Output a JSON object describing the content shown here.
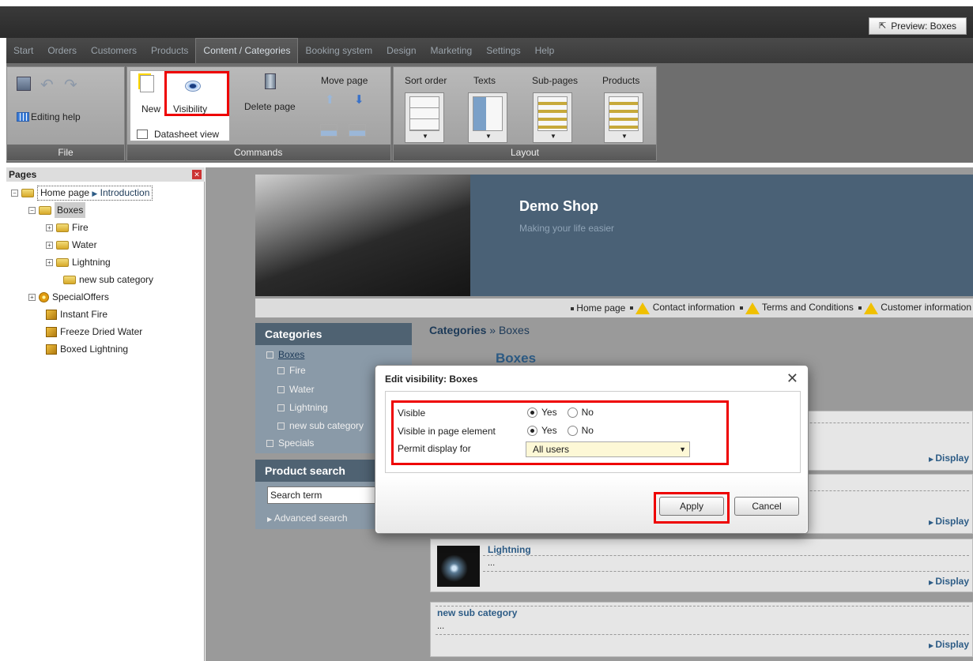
{
  "topbar": {
    "preview_label": "Preview: Boxes"
  },
  "menu": [
    "Start",
    "Orders",
    "Customers",
    "Products",
    "Content / Categories",
    "Booking system",
    "Design",
    "Marketing",
    "Settings",
    "Help"
  ],
  "ribbon": {
    "file": {
      "editing_help": "Editing help",
      "caption": "File"
    },
    "commands": {
      "new": "New",
      "visibility": "Visibility",
      "datasheet": "Datasheet view",
      "delete": "Delete page",
      "move": "Move page",
      "caption": "Commands"
    },
    "layout": {
      "sort": "Sort order",
      "texts": "Texts",
      "subpages": "Sub-pages",
      "products": "Products",
      "caption": "Layout"
    }
  },
  "pages": {
    "title": "Pages",
    "home": "Home page",
    "intro": "Introduction",
    "items": [
      "Boxes",
      "Fire",
      "Water",
      "Lightning",
      "new sub category",
      "SpecialOffers",
      "Instant Fire",
      "Freeze Dried Water",
      "Boxed Lightning"
    ]
  },
  "banner": {
    "title": "Demo Shop",
    "subtitle": "Making your life easier"
  },
  "nav": [
    "Home page",
    "Contact information",
    "Terms and Conditions",
    "Customer information"
  ],
  "categories": {
    "title": "Categories",
    "items": [
      "Boxes",
      "Fire",
      "Water",
      "Lightning",
      "new sub category",
      "Specials"
    ]
  },
  "search": {
    "title": "Product search",
    "placeholder": "Search term",
    "advanced": "Advanced search"
  },
  "breadcrumb": {
    "root": "Categories",
    "sep": "»",
    "current": "Boxes"
  },
  "page_heading": "Boxes",
  "products": [
    {
      "name": "Lightning",
      "desc": "..."
    },
    {
      "name": "new sub category",
      "desc": "..."
    }
  ],
  "display_label": "Display",
  "dialog": {
    "title": "Edit visibility: Boxes",
    "visible_label": "Visible",
    "visible_pe_label": "Visible in page element",
    "permit_label": "Permit display for",
    "yes": "Yes",
    "no": "No",
    "permit_value": "All users",
    "apply": "Apply",
    "cancel": "Cancel"
  }
}
